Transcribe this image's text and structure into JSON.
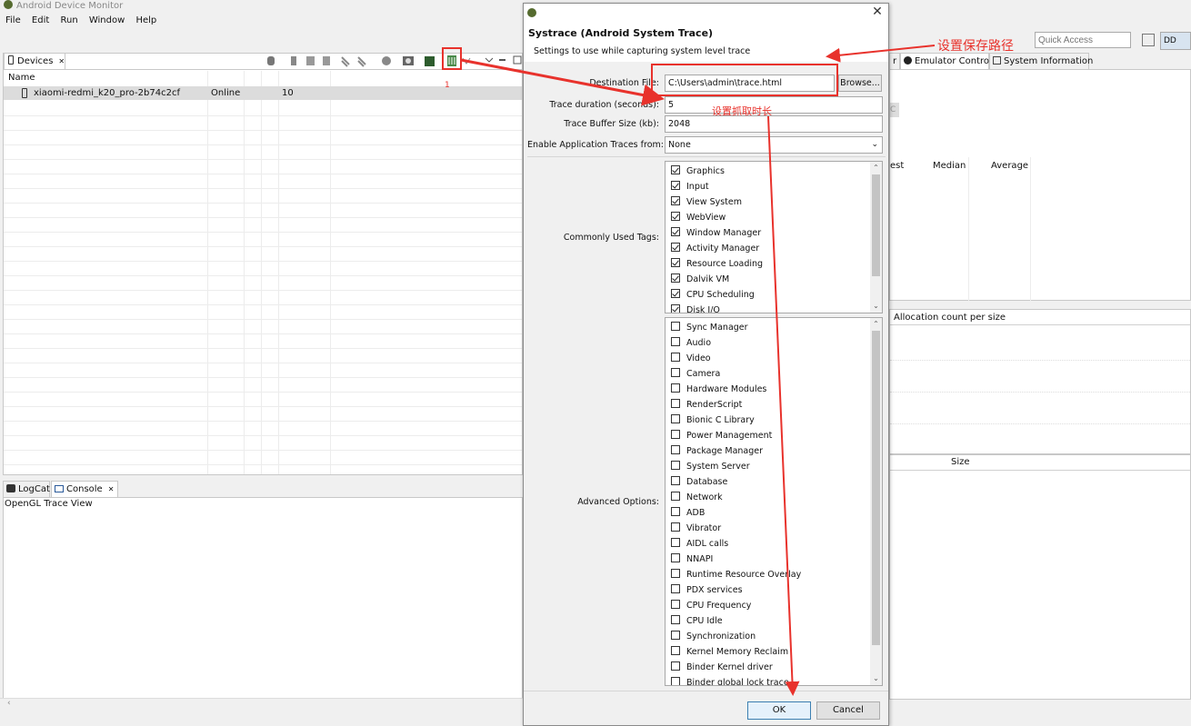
{
  "app": {
    "title": "Android Device Monitor"
  },
  "menu": [
    "File",
    "Edit",
    "Run",
    "Window",
    "Help"
  ],
  "toolbar": {
    "quick_access_placeholder": "Quick Access",
    "perspective_label": "DD"
  },
  "devices_view": {
    "tab_label": "Devices",
    "column_name": "Name",
    "device": {
      "name": "xiaomi-redmi_k20_pro-2b74c2cf",
      "status": "Online",
      "api": "10"
    }
  },
  "bottom_view": {
    "tabs": [
      "LogCat",
      "Console"
    ],
    "content_label": "OpenGL Trace View"
  },
  "right_view": {
    "tabs": [
      "r",
      "Emulator Control",
      "System Information"
    ],
    "table_headers": [
      "est",
      "Median",
      "Average"
    ],
    "allocation_label": "Allocation count per size",
    "size_label": "Size",
    "partial_button": "C"
  },
  "dialog": {
    "title": "Systrace (Android System Trace)",
    "description": "Settings to use while capturing system level trace",
    "destination_label": "Destination File:",
    "destination_value": "C:\\Users\\admin\\trace.html",
    "browse_label": "Browse...",
    "duration_label": "Trace duration (seconds):",
    "duration_value": "5",
    "buffer_label": "Trace Buffer Size (kb):",
    "buffer_value": "2048",
    "app_traces_label": "Enable Application Traces from:",
    "app_traces_value": "None",
    "common_tags_label": "Commonly Used Tags:",
    "common_tags": [
      {
        "label": "Graphics",
        "checked": true
      },
      {
        "label": "Input",
        "checked": true
      },
      {
        "label": "View System",
        "checked": true
      },
      {
        "label": "WebView",
        "checked": true
      },
      {
        "label": "Window Manager",
        "checked": true
      },
      {
        "label": "Activity Manager",
        "checked": true
      },
      {
        "label": "Resource Loading",
        "checked": true
      },
      {
        "label": "Dalvik VM",
        "checked": true
      },
      {
        "label": "CPU Scheduling",
        "checked": true
      },
      {
        "label": "Disk I/O",
        "checked": true
      }
    ],
    "advanced_label": "Advanced Options:",
    "advanced_tags": [
      {
        "label": "Sync Manager",
        "checked": false
      },
      {
        "label": "Audio",
        "checked": false
      },
      {
        "label": "Video",
        "checked": false
      },
      {
        "label": "Camera",
        "checked": false
      },
      {
        "label": "Hardware Modules",
        "checked": false
      },
      {
        "label": "RenderScript",
        "checked": false
      },
      {
        "label": "Bionic C Library",
        "checked": false
      },
      {
        "label": "Power Management",
        "checked": false
      },
      {
        "label": "Package Manager",
        "checked": false
      },
      {
        "label": "System Server",
        "checked": false
      },
      {
        "label": "Database",
        "checked": false
      },
      {
        "label": "Network",
        "checked": false
      },
      {
        "label": "ADB",
        "checked": false
      },
      {
        "label": "Vibrator",
        "checked": false
      },
      {
        "label": "AIDL calls",
        "checked": false
      },
      {
        "label": "NNAPI",
        "checked": false
      },
      {
        "label": "Runtime Resource Overlay",
        "checked": false
      },
      {
        "label": "PDX services",
        "checked": false
      },
      {
        "label": "CPU Frequency",
        "checked": false
      },
      {
        "label": "CPU Idle",
        "checked": false
      },
      {
        "label": "Synchronization",
        "checked": false
      },
      {
        "label": "Kernel Memory Reclaim",
        "checked": false
      },
      {
        "label": "Binder Kernel driver",
        "checked": false
      },
      {
        "label": "Binder global lock trace",
        "checked": false
      }
    ],
    "ok_label": "OK",
    "cancel_label": "Cancel"
  },
  "annotations": {
    "save_path": "设置保存路径",
    "duration": "设置抓取时长",
    "step_number": "1",
    "color": "#e8322c"
  }
}
